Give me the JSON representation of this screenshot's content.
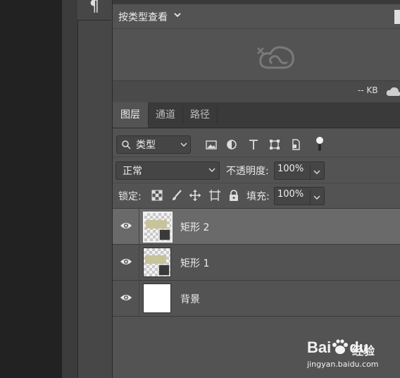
{
  "library": {
    "view_select": "按类型查看",
    "size_text": "-- KB"
  },
  "tabs": [
    {
      "label": "图层",
      "active": true
    },
    {
      "label": "通道",
      "active": false
    },
    {
      "label": "路径",
      "active": false
    }
  ],
  "filter": {
    "kind_label": "类型",
    "icons": [
      "image-filter-icon",
      "adjustment-filter-icon",
      "type-filter-icon",
      "shape-filter-icon",
      "smart-object-filter-icon",
      "filter-toggle-icon"
    ]
  },
  "blend": {
    "mode": "正常",
    "opacity_label": "不透明度:",
    "opacity_value": "100%"
  },
  "lock": {
    "label": "锁定:",
    "icons": [
      "lock-transparent-pixels-icon",
      "lock-image-pixels-icon",
      "lock-position-icon",
      "lock-artboard-icon",
      "lock-all-icon"
    ],
    "fill_label": "填充:",
    "fill_value": "100%"
  },
  "layers": [
    {
      "name": "矩形 2",
      "selected": true,
      "type": "shape"
    },
    {
      "name": "矩形 1",
      "selected": false,
      "type": "shape"
    },
    {
      "name": "背景",
      "selected": false,
      "type": "background"
    }
  ],
  "watermark": {
    "logo": "Bai",
    "logo2": "du",
    "brand": "经验",
    "url": "jingyan.baidu.com"
  },
  "colors": {
    "panel": "#535353",
    "selected_layer": "#6a6a6a",
    "shape_fill": "#c7c39a"
  }
}
